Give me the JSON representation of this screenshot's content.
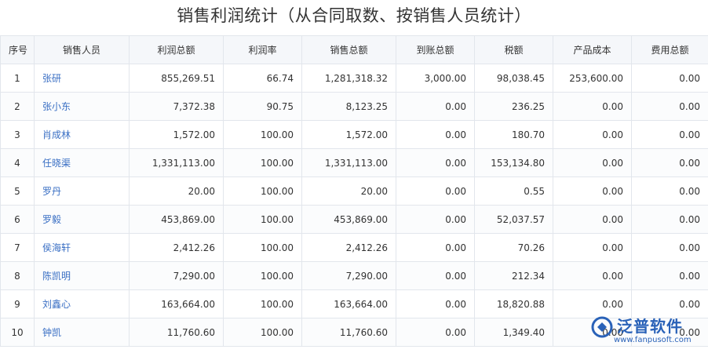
{
  "title": "销售利润统计（从合同取数、按销售人员统计）",
  "columns": [
    "序号",
    "销售人员",
    "利润总额",
    "利润率",
    "销售总额",
    "到账总额",
    "税额",
    "产品成本",
    "费用总额"
  ],
  "rows": [
    {
      "no": "1",
      "name": "张研",
      "profit": "855,269.51",
      "rate": "66.74",
      "sales": "1,281,318.32",
      "received": "3,000.00",
      "tax": "98,038.45",
      "cost": "253,600.00",
      "expense": "0.00"
    },
    {
      "no": "2",
      "name": "张小东",
      "profit": "7,372.38",
      "rate": "90.75",
      "sales": "8,123.25",
      "received": "0.00",
      "tax": "236.25",
      "cost": "0.00",
      "expense": "0.00"
    },
    {
      "no": "3",
      "name": "肖成林",
      "profit": "1,572.00",
      "rate": "100.00",
      "sales": "1,572.00",
      "received": "0.00",
      "tax": "180.70",
      "cost": "0.00",
      "expense": "0.00"
    },
    {
      "no": "4",
      "name": "任晓渠",
      "profit": "1,331,113.00",
      "rate": "100.00",
      "sales": "1,331,113.00",
      "received": "0.00",
      "tax": "153,134.80",
      "cost": "0.00",
      "expense": "0.00"
    },
    {
      "no": "5",
      "name": "罗丹",
      "profit": "20.00",
      "rate": "100.00",
      "sales": "20.00",
      "received": "0.00",
      "tax": "0.55",
      "cost": "0.00",
      "expense": "0.00"
    },
    {
      "no": "6",
      "name": "罗毅",
      "profit": "453,869.00",
      "rate": "100.00",
      "sales": "453,869.00",
      "received": "0.00",
      "tax": "52,037.57",
      "cost": "0.00",
      "expense": "0.00"
    },
    {
      "no": "7",
      "name": "侯海轩",
      "profit": "2,412.26",
      "rate": "100.00",
      "sales": "2,412.26",
      "received": "0.00",
      "tax": "70.26",
      "cost": "0.00",
      "expense": "0.00"
    },
    {
      "no": "8",
      "name": "陈凯明",
      "profit": "7,290.00",
      "rate": "100.00",
      "sales": "7,290.00",
      "received": "0.00",
      "tax": "212.34",
      "cost": "0.00",
      "expense": "0.00"
    },
    {
      "no": "9",
      "name": "刘鑫心",
      "profit": "163,664.00",
      "rate": "100.00",
      "sales": "163,664.00",
      "received": "0.00",
      "tax": "18,820.88",
      "cost": "0.00",
      "expense": "0.00"
    },
    {
      "no": "10",
      "name": "钟凯",
      "profit": "11,760.60",
      "rate": "100.00",
      "sales": "11,760.60",
      "received": "0.00",
      "tax": "1,349.40",
      "cost": "0.00",
      "expense": "0.00"
    }
  ],
  "watermark": {
    "brand": "泛普软件",
    "url": "www.fanpusoft.com",
    "icon": "fanpu-logo-icon",
    "color": "#2a62b8"
  },
  "colors": {
    "link": "#3a6fc4",
    "header_bg": "#f5f7fa",
    "border": "#e2e6ec"
  }
}
